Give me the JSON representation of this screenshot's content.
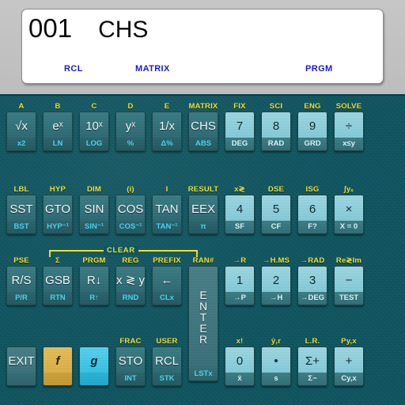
{
  "device": {
    "name": "HP-15C scientific calculator emulator",
    "body_color": "#0d5560",
    "bezel_color": "#c3c3c3",
    "accent_yellow": "#f2e32a",
    "accent_cyan": "#49d6ef",
    "f_key_color": "#e0b848",
    "g_key_color": "#3ec8e8",
    "annunciator_color": "#1a17e8"
  },
  "display": {
    "step": "001",
    "operation": "CHS",
    "annunciators": [
      {
        "label": "RCL",
        "active": true
      },
      {
        "label": "MATRIX",
        "active": true
      },
      {
        "label": "PRGM",
        "active": true
      }
    ]
  },
  "keys": {
    "row1": [
      {
        "top": "A",
        "face": "√x",
        "sub": "x2",
        "style": "dark",
        "name": "sqrt"
      },
      {
        "top": "B",
        "face": "eˣ",
        "sub": "LN",
        "style": "dark",
        "name": "e-to-x"
      },
      {
        "top": "C",
        "face": "10ˣ",
        "sub": "LOG",
        "style": "dark",
        "name": "ten-to-x"
      },
      {
        "top": "D",
        "face": "yˣ",
        "sub": "%",
        "style": "dark",
        "name": "y-to-x"
      },
      {
        "top": "E",
        "face": "1/x",
        "sub": "Δ%",
        "style": "dark",
        "name": "reciprocal"
      },
      {
        "top": "MATRIX",
        "face": "CHS",
        "sub": "ABS",
        "style": "dark",
        "name": "chs"
      },
      {
        "top": "FIX",
        "face": "7",
        "sub": "DEG",
        "style": "num",
        "name": "seven"
      },
      {
        "top": "SCI",
        "face": "8",
        "sub": "RAD",
        "style": "num",
        "name": "eight"
      },
      {
        "top": "ENG",
        "face": "9",
        "sub": "GRD",
        "style": "num",
        "name": "nine"
      },
      {
        "top": "SOLVE",
        "face": "÷",
        "sub": "x≤y",
        "style": "num",
        "name": "divide"
      }
    ],
    "row2": [
      {
        "top": "LBL",
        "face": "SST",
        "sub": "BST",
        "style": "dark",
        "name": "sst"
      },
      {
        "top": "HYP",
        "face": "GTO",
        "sub": "HYP⁻¹",
        "style": "dark",
        "name": "gto"
      },
      {
        "top": "DIM",
        "face": "SIN",
        "sub": "SIN⁻¹",
        "style": "dark",
        "name": "sin"
      },
      {
        "top": "(i)",
        "face": "COS",
        "sub": "COS⁻¹",
        "style": "dark",
        "name": "cos"
      },
      {
        "top": "I",
        "face": "TAN",
        "sub": "TAN⁻¹",
        "style": "dark",
        "name": "tan"
      },
      {
        "top": "RESULT",
        "face": "EEX",
        "sub": "π",
        "style": "dark",
        "name": "eex"
      },
      {
        "top": "x≷",
        "face": "4",
        "sub": "SF",
        "style": "num",
        "name": "four"
      },
      {
        "top": "DSE",
        "face": "5",
        "sub": "CF",
        "style": "num",
        "name": "five"
      },
      {
        "top": "ISG",
        "face": "6",
        "sub": "F?",
        "style": "num",
        "name": "six"
      },
      {
        "top": "∫yₓ",
        "face": "×",
        "sub": "X = 0",
        "style": "num",
        "name": "multiply"
      }
    ],
    "row3": [
      {
        "top": "PSE",
        "face": "R/S",
        "sub": "P/R",
        "style": "dark",
        "name": "run-stop"
      },
      {
        "top": "Σ",
        "face": "GSB",
        "sub": "RTN",
        "style": "dark",
        "name": "gsb"
      },
      {
        "top": "PRGM",
        "face": "R↓",
        "sub": "R↑",
        "style": "dark",
        "name": "roll-down"
      },
      {
        "top": "REG",
        "face": "x ≷ y",
        "sub": "RND",
        "style": "dark",
        "name": "x-exchange-y"
      },
      {
        "top": "PREFIX",
        "face": "←",
        "sub": "CLx",
        "style": "dark",
        "name": "backspace"
      },
      {
        "top": "RAN#",
        "face": "ENTER",
        "sub": "LSTx",
        "style": "gray",
        "name": "enter",
        "tall": true
      },
      {
        "top": "→R",
        "face": "1",
        "sub": "→P",
        "style": "num",
        "name": "one"
      },
      {
        "top": "→H.MS",
        "face": "2",
        "sub": "→H",
        "style": "num",
        "name": "two"
      },
      {
        "top": "→RAD",
        "face": "3",
        "sub": "→DEG",
        "style": "num",
        "name": "three"
      },
      {
        "top": "Re≷Im",
        "face": "−",
        "sub": "TEST",
        "style": "num",
        "name": "subtract"
      }
    ],
    "row4": [
      {
        "top": "",
        "face": "EXIT",
        "sub": "",
        "style": "gray",
        "name": "exit"
      },
      {
        "top": "",
        "face": "f",
        "sub": "",
        "style": "f",
        "name": "f-shift"
      },
      {
        "top": "",
        "face": "g",
        "sub": "",
        "style": "g",
        "name": "g-shift"
      },
      {
        "top": "FRAC",
        "face": "STO",
        "sub": "INT",
        "style": "dark",
        "name": "sto"
      },
      {
        "top": "USER",
        "face": "RCL",
        "sub": "STK",
        "style": "dark",
        "name": "rcl"
      },
      {
        "top": "x!",
        "face": "0",
        "sub": "x̄",
        "style": "num",
        "name": "zero"
      },
      {
        "top": "ŷ,r",
        "face": "•",
        "sub": "s",
        "style": "num",
        "name": "decimal-point"
      },
      {
        "top": "L.R.",
        "face": "Σ+",
        "sub": "Σ−",
        "style": "num",
        "name": "sigma-plus"
      },
      {
        "top": "Py,x",
        "face": "+",
        "sub": "Cy,x",
        "style": "num",
        "name": "add"
      }
    ]
  },
  "clear_bracket": {
    "label": "CLEAR"
  }
}
